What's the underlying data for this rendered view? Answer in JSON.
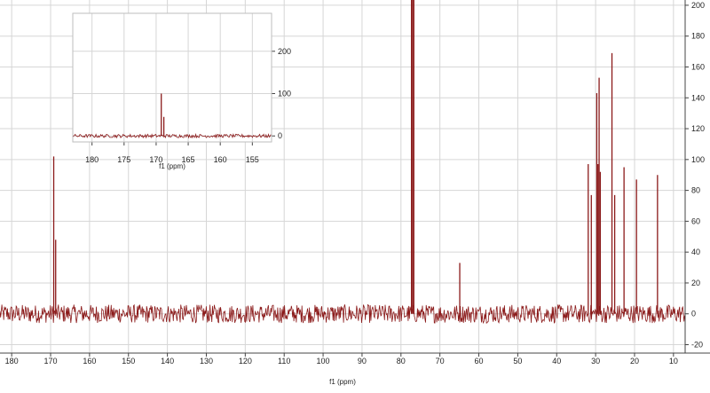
{
  "chart_data": [
    {
      "type": "line",
      "title": "",
      "xlabel": "f1 (ppm)",
      "ylabel": "",
      "xlim": [
        183,
        7
      ],
      "ylim": [
        -22,
        208
      ],
      "x_ticks": [
        180,
        170,
        160,
        150,
        140,
        130,
        120,
        110,
        100,
        90,
        80,
        70,
        60,
        50,
        40,
        30,
        20,
        10
      ],
      "y_ticks": [
        -20,
        0,
        20,
        40,
        60,
        80,
        100,
        120,
        140,
        160,
        180,
        200
      ],
      "y_axis_side": "right",
      "grid": true,
      "series_color": "#8b1a1a",
      "noise_amplitude": 6,
      "peaks": [
        {
          "x": 169.2,
          "y": 102
        },
        {
          "x": 168.7,
          "y": 48
        },
        {
          "x": 77.3,
          "y": 208
        },
        {
          "x": 77.0,
          "y": 208
        },
        {
          "x": 76.7,
          "y": 208
        },
        {
          "x": 64.9,
          "y": 33
        },
        {
          "x": 31.9,
          "y": 97
        },
        {
          "x": 31.1,
          "y": 77
        },
        {
          "x": 29.7,
          "y": 143
        },
        {
          "x": 29.4,
          "y": 97
        },
        {
          "x": 29.1,
          "y": 153
        },
        {
          "x": 28.8,
          "y": 92
        },
        {
          "x": 25.8,
          "y": 169
        },
        {
          "x": 25.1,
          "y": 77
        },
        {
          "x": 22.7,
          "y": 95
        },
        {
          "x": 19.5,
          "y": 87
        },
        {
          "x": 14.1,
          "y": 90
        }
      ]
    },
    {
      "type": "line",
      "title": "",
      "xlabel": "f1 (ppm)",
      "ylabel": "",
      "xlim": [
        183,
        152
      ],
      "ylim": [
        -10,
        275
      ],
      "x_ticks": [
        180,
        175,
        170,
        165,
        160,
        155
      ],
      "y_ticks": [
        0,
        100,
        200
      ],
      "y_axis_side": "right",
      "grid": true,
      "series_color": "#8b1a1a",
      "noise_amplitude": 4,
      "peaks": [
        {
          "x": 169.2,
          "y": 100
        },
        {
          "x": 168.8,
          "y": 45
        }
      ]
    }
  ]
}
